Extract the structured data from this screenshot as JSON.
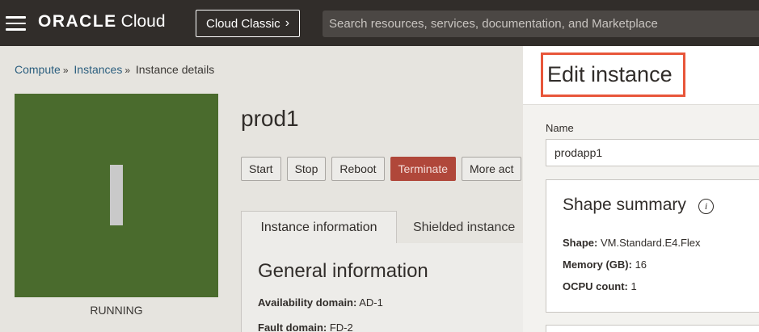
{
  "topbar": {
    "brand": "ORACLE",
    "product": "Cloud",
    "classic_label": "Cloud Classic",
    "search_placeholder": "Search resources, services, documentation, and Marketplace"
  },
  "breadcrumb": {
    "items": [
      "Compute",
      "Instances",
      "Instance details"
    ]
  },
  "instance": {
    "name": "prod1",
    "state": "RUNNING",
    "actions": [
      "Start",
      "Stop",
      "Reboot",
      "Terminate",
      "More act"
    ],
    "tabs": [
      "Instance information",
      "Shielded instance"
    ],
    "section_title": "General information",
    "fields": [
      {
        "label": "Availability domain:",
        "value": "AD-1"
      },
      {
        "label": "Fault domain:",
        "value": "FD-2"
      }
    ]
  },
  "panel": {
    "title": "Edit instance",
    "name_label": "Name",
    "name_value": "prodapp1",
    "shape_summary": {
      "title": "Shape summary",
      "rows": [
        {
          "label": "Shape:",
          "value": "VM.Standard.E4.Flex"
        },
        {
          "label": "Memory (GB):",
          "value": "16"
        },
        {
          "label": "OCPU count:",
          "value": "1"
        }
      ]
    }
  },
  "colors": {
    "topbar": "#312d2a",
    "tile": "#4a6b2d",
    "terminate": "#b0473a",
    "highlight": "#e8563a"
  },
  "icons": [
    "hamburger-menu-icon",
    "chevron-right-icon",
    "info-icon",
    "status-tile-icon"
  ]
}
